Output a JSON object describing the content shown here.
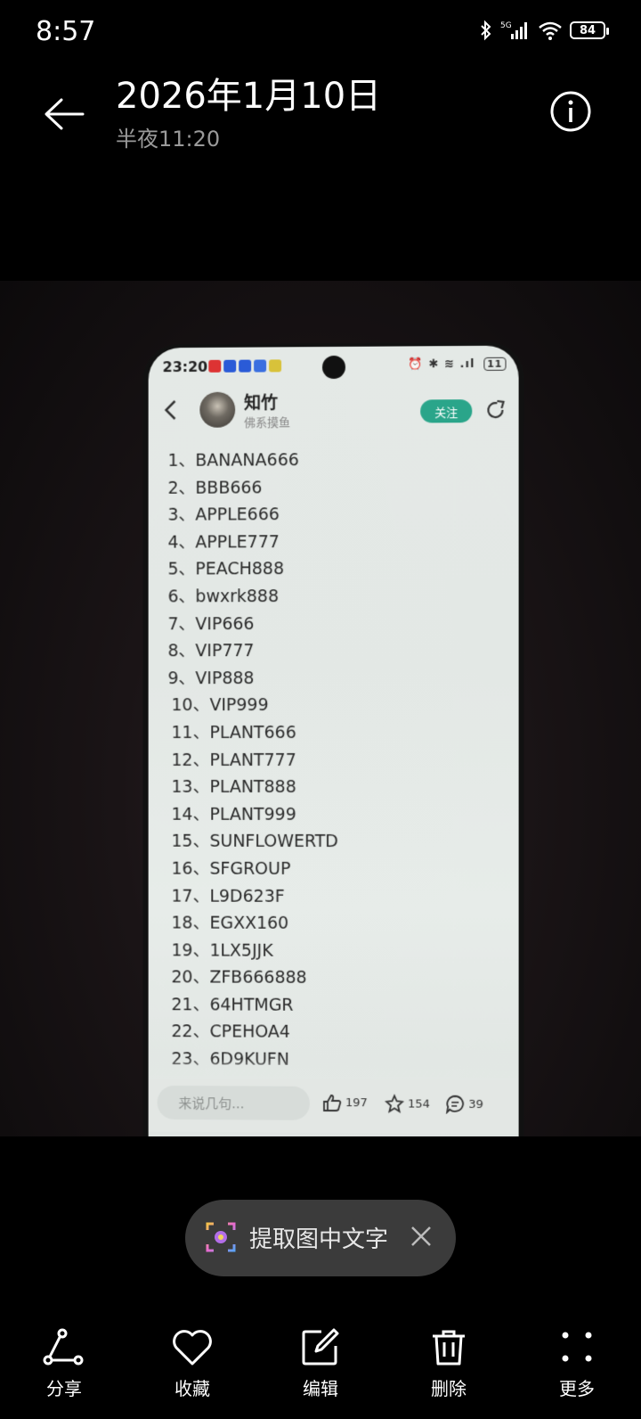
{
  "status_bar": {
    "time": "8:57",
    "battery": "84",
    "network": "5G"
  },
  "header": {
    "title": "2026年1月10日",
    "subtitle": "半夜11:20",
    "back_icon": "arrow-left-icon",
    "info_icon": "info-circle-icon"
  },
  "photo": {
    "phone_status": {
      "time": "23:20",
      "battery": "11"
    },
    "app_header": {
      "username": "知竹",
      "user_subtitle": "佛系摸鱼",
      "follow_label": "关注"
    },
    "list_items": [
      "1、BANANA666",
      "2、BBB666",
      "3、APPLE666",
      "4、APPLE777",
      "5、PEACH888",
      "6、bwxrk888",
      "7、VIP666",
      "8、VIP777",
      "9、VIP888",
      "10、VIP999",
      "11、PLANT666",
      "12、PLANT777",
      "13、PLANT888",
      "14、PLANT999",
      "15、SUNFLOWERTD",
      "16、SFGROUP",
      "17、L9D623F",
      "18、EGXX160",
      "19、1LX5JJK",
      "20、ZFB666888",
      "21、64HTMGR",
      "22、CPEHOA4",
      "23、6D9KUFN"
    ],
    "comment_placeholder": "来说几句...",
    "likes": "197",
    "favorites": "154",
    "comments": "39"
  },
  "ocr": {
    "label": "提取图中文字"
  },
  "toolbar": {
    "share": "分享",
    "favorite": "收藏",
    "edit": "编辑",
    "delete": "删除",
    "more": "更多"
  }
}
